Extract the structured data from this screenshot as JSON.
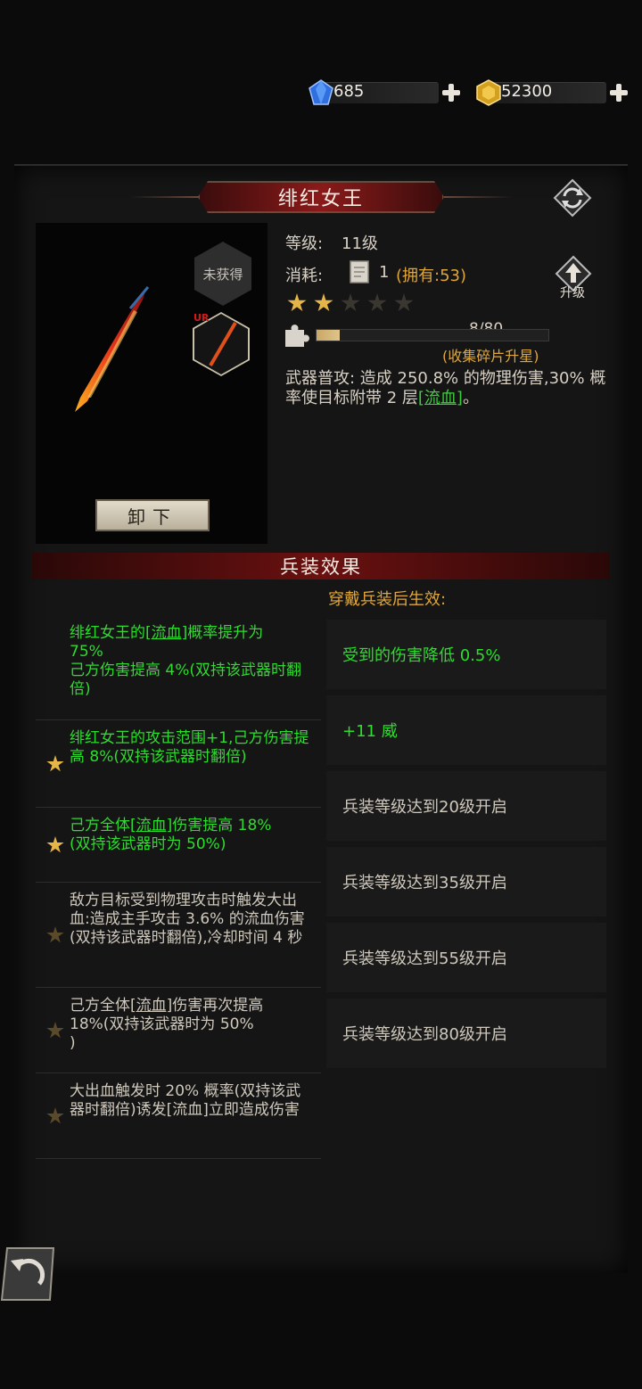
{
  "currencies": {
    "gems": {
      "value": "685",
      "icon": "blue-gem-icon"
    },
    "gold": {
      "value": "52300",
      "icon": "gold-gem-icon"
    }
  },
  "weapon": {
    "name": "绯红女王",
    "level_label": "等级:",
    "level_value": "11级",
    "cost_label": "消耗:",
    "cost_amount": "1",
    "cost_owned": "(拥有:53)",
    "stars_total": 5,
    "stars_filled": 2,
    "shard_progress": "8/80",
    "shard_fraction": 0.1,
    "shard_hint": "(收集碎片升星)",
    "not_owned": "未获得",
    "rarity": "UR",
    "upgrade_label": "升级",
    "unequip_label": "卸下",
    "desc_prefix": "武器普攻: 造成 250.8% 的物理伤害,30% 概率使目标附带 2 层",
    "desc_link": "[流血]",
    "desc_suffix": "。"
  },
  "effects": {
    "header": "兵装效果",
    "wear_label": "穿戴兵装后生效:",
    "skills": [
      {
        "parts": [
          "绯红女王的",
          "[流血]",
          "概率提升为\n75%\n己方伤害提高 4%(双持该武器时翻倍)"
        ],
        "active": true,
        "starred": false
      },
      {
        "text": "绯红女王的攻击范围+1,己方伤害提高 8%(双持该武器时翻倍)",
        "active": true,
        "starred": true
      },
      {
        "parts": [
          "己方全体",
          "[流血]",
          "伤害提高 18%\n(双持该武器时为 50%)"
        ],
        "active": true,
        "starred": true
      },
      {
        "text": "敌方目标受到物理攻击时触发大出血:造成主手攻击 3.6% 的流血伤害(双持该武器时翻倍),冷却时间 4 秒",
        "active": false,
        "starred": true
      },
      {
        "parts": [
          "己方全体",
          "[流血]",
          "伤害再次提高\n18%(双持该武器时为 50%\n)"
        ],
        "active": false,
        "starred": true
      },
      {
        "text": "大出血触发时 20% 概率(双持该武器时翻倍)诱发[流血]立即造成伤害",
        "active": false,
        "starred": true
      }
    ],
    "bonuses": [
      {
        "text": "受到的伤害降低 0.5%",
        "on": true
      },
      {
        "text": "+11 威",
        "on": true
      },
      {
        "text": "兵装等级达到20级开启",
        "on": false
      },
      {
        "text": "兵装等级达到35级开启",
        "on": false
      },
      {
        "text": "兵装等级达到55级开启",
        "on": false
      },
      {
        "text": "兵装等级达到80级开启",
        "on": false
      }
    ]
  }
}
